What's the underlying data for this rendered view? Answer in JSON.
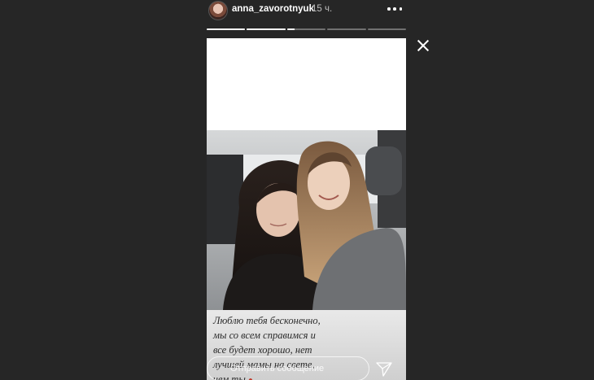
{
  "story": {
    "username": "anna_zavorotnyuk",
    "time": "15 ч.",
    "segments_progress": [
      1,
      1,
      0.2,
      0,
      0
    ],
    "caption_lines": [
      "Люблю тебя бесконечно,",
      "мы со всем справимся и",
      "все будет хорошо, нет",
      "лучшей мамы на свете,",
      "чем ты"
    ],
    "heart_icon": "heart-emoji"
  },
  "reply": {
    "placeholder": "Отправить сообщение"
  },
  "icons": {
    "more": "more-dots-icon",
    "close": "close-icon",
    "send": "send-icon"
  },
  "colors": {
    "background": "#262626",
    "text": "#ffffff"
  }
}
